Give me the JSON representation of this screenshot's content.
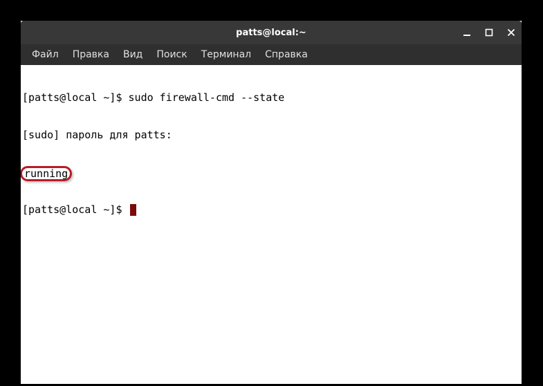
{
  "window": {
    "title": "patts@local:~"
  },
  "menu": {
    "file": "Файл",
    "edit": "Правка",
    "view": "Вид",
    "search": "Поиск",
    "terminal": "Терминал",
    "help": "Справка"
  },
  "terminal": {
    "line1_prompt": "[patts@local ~]$ ",
    "line1_cmd": "sudo firewall-cmd --state",
    "line2": "[sudo] пароль для patts: ",
    "line3_output": "running",
    "line4_prompt": "[patts@local ~]$ "
  }
}
